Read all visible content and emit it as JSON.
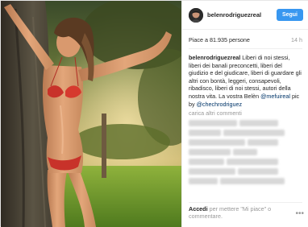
{
  "post": {
    "username": "belenrodriguezreal",
    "follow_label": "Segui",
    "likes_text": "Piace a 81.935 persone",
    "time": "14 h",
    "caption_user": "belenrodriguezreal",
    "caption_text": " Liberi di noi stessi, liberi dei banali preconcetti, liberi del giudizio e del giudicare, liberi di guardare gli altri con bontà, leggeri, consapevoli, ribadisco, liberi di noi stessi, autori della nostra vita. La vostra Belèn ",
    "caption_mention1": "@mefuireal",
    "caption_pic_prefix": " pic by ",
    "caption_mention2": "@chechrodriguez",
    "load_more": "carica altri commenti",
    "footer_login": "Accedi",
    "footer_text": " per mettere \"Mi piace\" o commentare.",
    "options_icon": "more-options-icon"
  },
  "colors": {
    "follow_button": "#3897f0",
    "link": "#003569",
    "muted": "#999999"
  }
}
